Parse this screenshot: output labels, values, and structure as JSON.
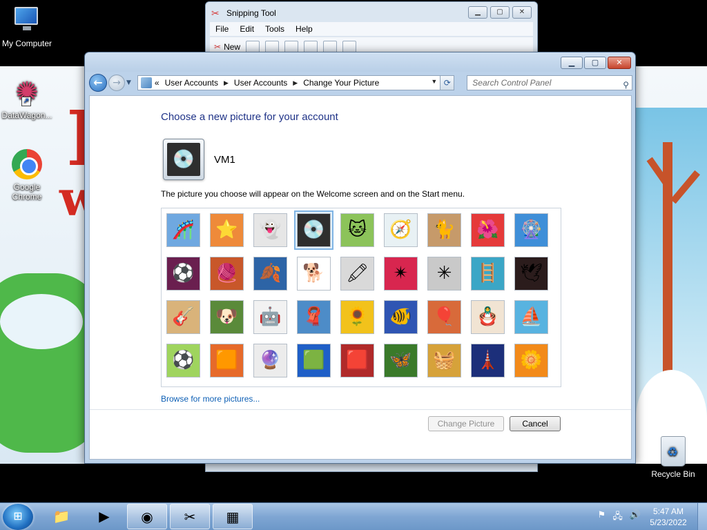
{
  "desktop": {
    "icons": {
      "my_computer": "My Computer",
      "datawagon": "DataWagon...",
      "chrome_line1": "Google",
      "chrome_line2": "Chrome",
      "recycle_bin": "Recycle Bin"
    }
  },
  "snipping_tool": {
    "title": "Snipping Tool",
    "menu": [
      "File",
      "Edit",
      "Tools",
      "Help"
    ],
    "new_label": "New"
  },
  "window": {
    "breadcrumb": [
      "User Accounts",
      "User Accounts",
      "Change Your Picture"
    ],
    "breadcrumb_prefix": "«",
    "search_placeholder": "Search Control Panel",
    "heading": "Choose a new picture for your account",
    "username": "VM1",
    "description": "The picture you choose will appear on the Welcome screen and on the Start menu.",
    "browse_link": "Browse for more pictures...",
    "change_button": "Change Picture",
    "cancel_button": "Cancel"
  },
  "pictures": [
    {
      "icon": "roller-coaster",
      "glyph": "🎢",
      "bg": "#6fa8e0"
    },
    {
      "icon": "starfish",
      "glyph": "⭐",
      "bg": "#ee8a3a"
    },
    {
      "icon": "robot-figure",
      "glyph": "👻",
      "bg": "#e6e6e6"
    },
    {
      "icon": "record-player",
      "glyph": "💿",
      "bg": "#2e2e2e",
      "selected": true
    },
    {
      "icon": "lucky-cat",
      "glyph": "🐱",
      "bg": "#8cc35a"
    },
    {
      "icon": "spinning-top",
      "glyph": "🧭",
      "bg": "#e8f1f4"
    },
    {
      "icon": "kitten",
      "glyph": "🐈",
      "bg": "#c69a6a"
    },
    {
      "icon": "flower",
      "glyph": "🌺",
      "bg": "#e53a3a"
    },
    {
      "icon": "ferris-wheel",
      "glyph": "🎡",
      "bg": "#3f8fd8"
    },
    {
      "icon": "ball",
      "glyph": "⚽",
      "bg": "#6a1f4f"
    },
    {
      "icon": "fabric",
      "glyph": "🧶",
      "bg": "#c8572a"
    },
    {
      "icon": "leaf",
      "glyph": "🍂",
      "bg": "#2d64a6"
    },
    {
      "icon": "dog",
      "glyph": "🐕",
      "bg": "#ffffff"
    },
    {
      "icon": "crayons",
      "glyph": "🖍",
      "bg": "#d9d9d9"
    },
    {
      "icon": "star-lantern",
      "glyph": "✴",
      "bg": "#d8264f"
    },
    {
      "icon": "jacks",
      "glyph": "✳",
      "bg": "#c9c9c9"
    },
    {
      "icon": "stairs",
      "glyph": "🪜",
      "bg": "#3ba6c6"
    },
    {
      "icon": "origami-crane",
      "glyph": "🕊",
      "bg": "#2b1c1c"
    },
    {
      "icon": "guitar",
      "glyph": "🎸",
      "bg": "#d9b37a"
    },
    {
      "icon": "puppy",
      "glyph": "🐶",
      "bg": "#5a8a3a"
    },
    {
      "icon": "toy-robot",
      "glyph": "🤖",
      "bg": "#f2f2f2"
    },
    {
      "icon": "scarves",
      "glyph": "🧣",
      "bg": "#4d8cc8"
    },
    {
      "icon": "sunflower",
      "glyph": "🌻",
      "bg": "#f2c21b"
    },
    {
      "icon": "fish",
      "glyph": "🐠",
      "bg": "#2f55b3"
    },
    {
      "icon": "hot-air-balloon",
      "glyph": "🎈",
      "bg": "#d86a3a"
    },
    {
      "icon": "doll",
      "glyph": "🪆",
      "bg": "#f1e4d3"
    },
    {
      "icon": "sailboat",
      "glyph": "⛵",
      "bg": "#58b3e0"
    },
    {
      "icon": "soccer-ball",
      "glyph": "⚽",
      "bg": "#9fd45e"
    },
    {
      "icon": "textile",
      "glyph": "🟧",
      "bg": "#e66a2a"
    },
    {
      "icon": "marbles",
      "glyph": "🔮",
      "bg": "#ececec"
    },
    {
      "icon": "window-frame",
      "glyph": "🟩",
      "bg": "#1f5fc7"
    },
    {
      "icon": "rug",
      "glyph": "🟥",
      "bg": "#b02a2a"
    },
    {
      "icon": "butterfly",
      "glyph": "🦋",
      "bg": "#3a7a2a"
    },
    {
      "icon": "basket",
      "glyph": "🧺",
      "bg": "#d6a23a"
    },
    {
      "icon": "lighthouse",
      "glyph": "🗼",
      "bg": "#1c2f7a"
    },
    {
      "icon": "orange-flower",
      "glyph": "🌼",
      "bg": "#f28a1a"
    }
  ],
  "taskbar": {
    "time": "5:47 AM",
    "date": "5/23/2022"
  }
}
